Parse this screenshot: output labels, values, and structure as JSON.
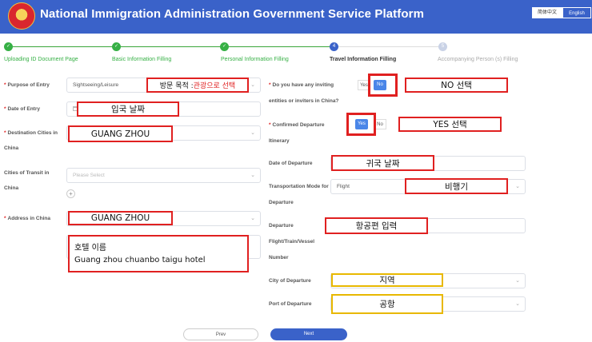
{
  "header": {
    "title": "National Immigration Administration Government Service Platform",
    "lang_cn": "简体中文",
    "lang_en": "English"
  },
  "steps": [
    {
      "num": "",
      "label": "Uploading ID Document Page",
      "state": "done"
    },
    {
      "num": "",
      "label": "Basic Information Filling",
      "state": "done"
    },
    {
      "num": "",
      "label": "Personal Information Filling",
      "state": "done"
    },
    {
      "num": "4",
      "label": "Travel Information Filling",
      "state": "active"
    },
    {
      "num": "5",
      "label": "Accompanying Person (s) Filling",
      "state": "todo"
    }
  ],
  "left": {
    "purpose": {
      "label": "Purpose of Entry",
      "value": "Sightseeing/Leisure"
    },
    "date_entry": {
      "label": "Date of Entry"
    },
    "destination": {
      "label": "Destination Cities in China"
    },
    "transit": {
      "label": "Cities of Transit in China",
      "placeholder": "Please Select"
    },
    "address": {
      "label": "Address in China"
    }
  },
  "right": {
    "inviting": {
      "label": "Do you have any inviting entities or inviters in China?",
      "yes": "Yes",
      "no": "No"
    },
    "itinerary": {
      "label": "Confirmed Departure Itinerary",
      "yes": "Yes",
      "no": "No"
    },
    "date_departure": {
      "label": "Date of Departure"
    },
    "transport": {
      "label": "Transportation Mode for Departure",
      "value": "Flight"
    },
    "flight_no": {
      "label": "Departure Flight/Train/Vessel Number"
    },
    "city_departure": {
      "label": "City of Departure"
    },
    "port_departure": {
      "label": "Port of Departure"
    }
  },
  "annotations": {
    "purpose_prefix": "방문 목적 : ",
    "purpose_highlight": "관광으로 선택",
    "date_entry": "입국 날짜",
    "destination": "GUANG ZHOU",
    "address_city": "GUANG ZHOU",
    "hotel_line1": "호텔 이름",
    "hotel_line2": "Guang zhou chuanbo taigu hotel",
    "no_select": "NO 선택",
    "yes_select": "YES 선택",
    "date_return": "귀국 날짜",
    "transport": "비행기",
    "flight_input": "항공편 입력",
    "region": "지역",
    "airport": "공항"
  },
  "buttons": {
    "prev": "Prev",
    "next": "Next"
  },
  "colors": {
    "header": "#3a62c9",
    "done": "#36b045",
    "annotation_red": "#e02020",
    "annotation_yellow": "#e8b800",
    "toggle_on": "#4a86e8"
  }
}
